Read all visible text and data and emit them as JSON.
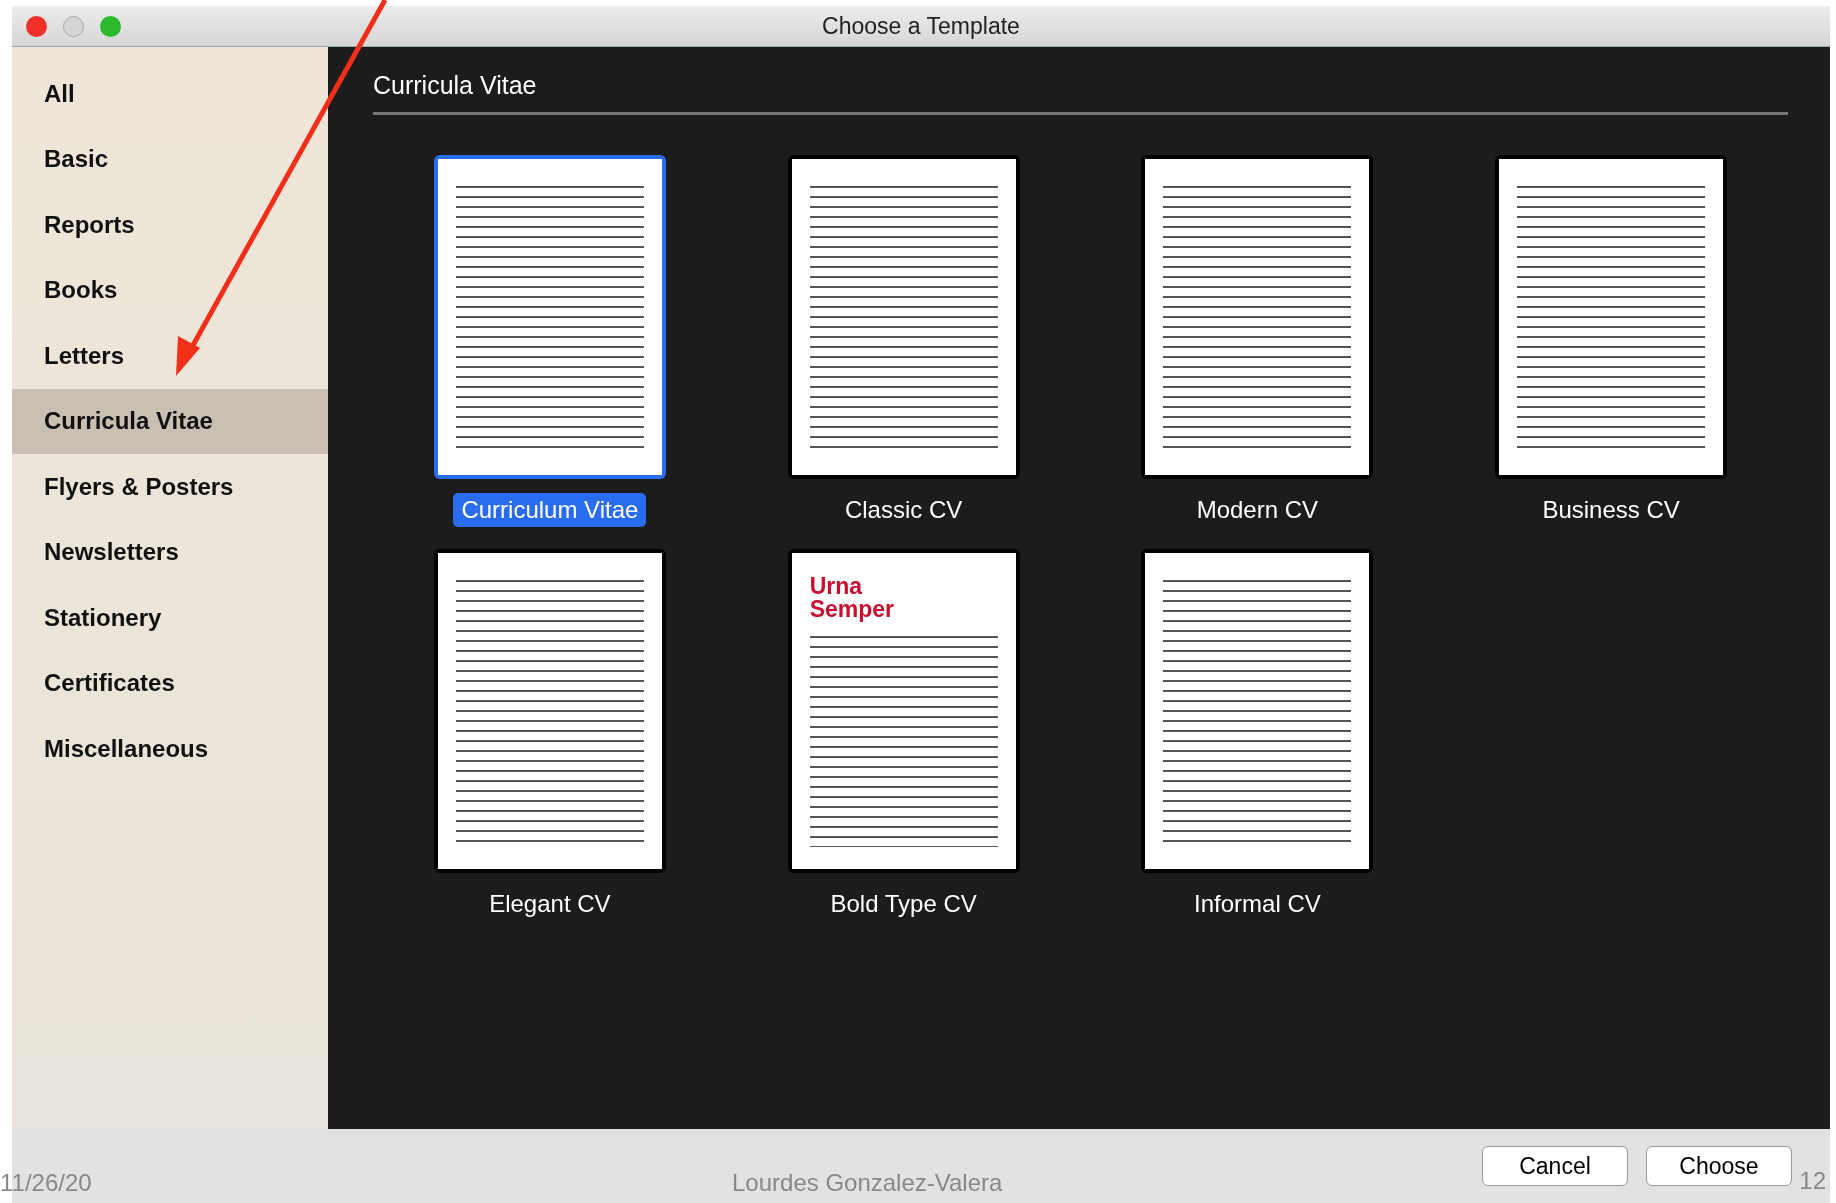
{
  "window": {
    "title": "Choose a Template"
  },
  "sidebar": {
    "items": [
      {
        "label": "All",
        "selected": false
      },
      {
        "label": "Basic",
        "selected": false
      },
      {
        "label": "Reports",
        "selected": false
      },
      {
        "label": "Books",
        "selected": false
      },
      {
        "label": "Letters",
        "selected": false
      },
      {
        "label": "Curricula Vitae",
        "selected": true
      },
      {
        "label": "Flyers & Posters",
        "selected": false
      },
      {
        "label": "Newsletters",
        "selected": false
      },
      {
        "label": "Stationery",
        "selected": false
      },
      {
        "label": "Certificates",
        "selected": false
      },
      {
        "label": "Miscellaneous",
        "selected": false
      }
    ]
  },
  "section": {
    "title": "Curricula Vitae"
  },
  "templates": [
    {
      "label": "Curriculum Vitae",
      "selected": true
    },
    {
      "label": "Classic CV",
      "selected": false
    },
    {
      "label": "Modern CV",
      "selected": false
    },
    {
      "label": "Business CV",
      "selected": false
    },
    {
      "label": "Elegant CV",
      "selected": false
    },
    {
      "label": "Bold Type CV",
      "selected": false,
      "heading": "Urna Semper"
    },
    {
      "label": "Informal CV",
      "selected": false
    }
  ],
  "buttons": [
    "Cancel",
    "Choose"
  ],
  "slide_footer": {
    "date": "11/26/20",
    "author": "Lourdes Gonzalez-Valera",
    "slide_number": "12"
  }
}
